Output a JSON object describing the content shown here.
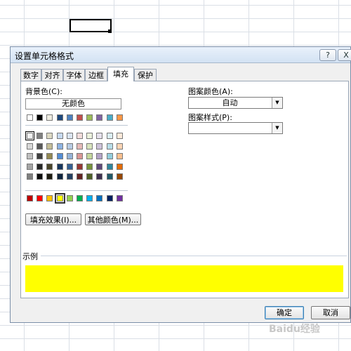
{
  "dialog": {
    "title": "设置单元格格式",
    "help_label": "?",
    "close_label": "X"
  },
  "tabs": [
    {
      "label": "数字",
      "active": false
    },
    {
      "label": "对齐",
      "active": false
    },
    {
      "label": "字体",
      "active": false
    },
    {
      "label": "边框",
      "active": false
    },
    {
      "label": "填充",
      "active": true
    },
    {
      "label": "保护",
      "active": false
    }
  ],
  "fill": {
    "background_color_label": "背景色(C):",
    "no_color_label": "无颜色",
    "pattern_color_label": "图案颜色(A):",
    "pattern_color_value": "自动",
    "pattern_style_label": "图案样式(P):",
    "pattern_style_value": "",
    "fill_effects_label": "填充效果(I)...",
    "more_colors_label": "其他颜色(M)...",
    "sample_label": "示例",
    "sample_color": "#ffff00"
  },
  "palette": {
    "theme_top_row": [
      "#ffffff",
      "#000000",
      "#eeece1",
      "#1f497d",
      "#4f81bd",
      "#c0504d",
      "#9bbb59",
      "#8064a2",
      "#4bacc6",
      "#f79646"
    ],
    "theme_shades": [
      [
        "#f2f2f2",
        "#7f7f7f",
        "#ddd9c3",
        "#c6d9f0",
        "#dbe5f1",
        "#f2dcdb",
        "#ebf1dd",
        "#e5e0ec",
        "#dbeef3",
        "#fdeada"
      ],
      [
        "#d8d8d8",
        "#595959",
        "#c4bd97",
        "#8db3e2",
        "#b8cce4",
        "#e5b9b7",
        "#d7e3bc",
        "#ccc1d9",
        "#b7dde8",
        "#fbd5b5"
      ],
      [
        "#bfbfbf",
        "#3f3f3f",
        "#938953",
        "#548dd4",
        "#95b3d7",
        "#d99694",
        "#c3d69b",
        "#b2a2c7",
        "#92cddc",
        "#fac08f"
      ],
      [
        "#a5a5a5",
        "#262626",
        "#494429",
        "#17365d",
        "#366092",
        "#953734",
        "#76923c",
        "#5f497a",
        "#31859b",
        "#e36c09"
      ],
      [
        "#7f7f7f",
        "#0c0c0c",
        "#1d1b10",
        "#0f243e",
        "#244061",
        "#632423",
        "#4f6128",
        "#3f3151",
        "#205867",
        "#974806"
      ]
    ],
    "standard": [
      "#c00000",
      "#ff0000",
      "#ffc000",
      "#ffff00",
      "#92d050",
      "#00b050",
      "#00b0f0",
      "#0070c0",
      "#002060",
      "#7030a0"
    ]
  },
  "footer": {
    "ok_label": "确定",
    "cancel_label": "取消"
  },
  "watermark": "Baidu经验"
}
